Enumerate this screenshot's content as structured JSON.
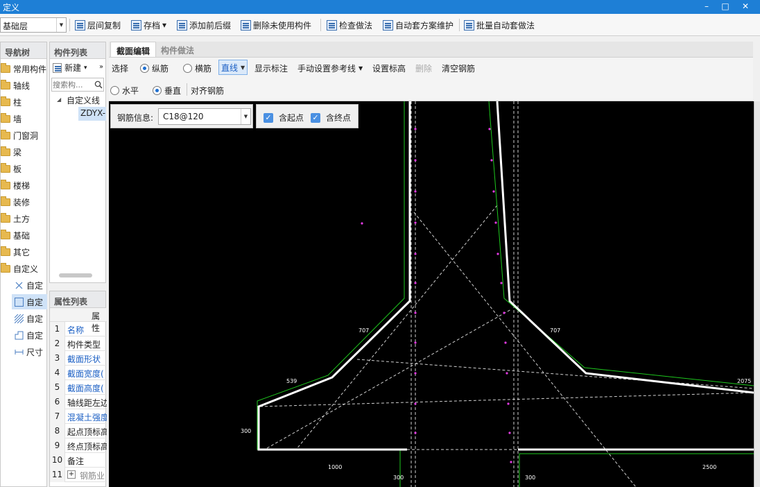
{
  "window": {
    "title": "定义",
    "min": "–",
    "max": "□",
    "close": "✕"
  },
  "toolbar": {
    "layer_value": "基础层",
    "items": [
      "层间复制",
      "存档",
      "添加前后缀",
      "删除未使用构件",
      "检查做法",
      "自动套方案维护",
      "批量自动套做法"
    ],
    "archive_arrow": "▾"
  },
  "nav": {
    "header": "导航树",
    "items": [
      "常用构件",
      "轴线",
      "柱",
      "墙",
      "门窗洞",
      "梁",
      "板",
      "楼梯",
      "装修",
      "土方",
      "基础",
      "其它",
      "自定义"
    ],
    "sub_items": [
      "自定",
      "自定",
      "自定",
      "自定",
      "尺寸"
    ]
  },
  "components": {
    "header": "构件列表",
    "new_label": "新建",
    "new_arrow": "▾",
    "more": "»",
    "search_placeholder": "搜索构...",
    "tree_parent": "自定义线",
    "tree_child": "ZDYX-"
  },
  "props": {
    "header": "属性列表",
    "col_header": "属性",
    "rows": [
      {
        "n": "1",
        "name": "名称",
        "blue": true
      },
      {
        "n": "2",
        "name": "构件类型",
        "blue": false
      },
      {
        "n": "3",
        "name": "截面形状",
        "blue": true
      },
      {
        "n": "4",
        "name": "截面宽度(",
        "blue": true
      },
      {
        "n": "5",
        "name": "截面高度(",
        "blue": true
      },
      {
        "n": "6",
        "name": "轴线距左边",
        "blue": false
      },
      {
        "n": "7",
        "name": "混凝土强度",
        "blue": true
      },
      {
        "n": "8",
        "name": "起点顶标高",
        "blue": false
      },
      {
        "n": "9",
        "name": "终点顶标高",
        "blue": false
      },
      {
        "n": "10",
        "name": "备注",
        "blue": false
      },
      {
        "n": "11",
        "name": "钢筋业",
        "blue": false
      }
    ],
    "expand": "+"
  },
  "editor": {
    "tab_active": "截面编辑",
    "tab_inactive": "构件做法",
    "row1": {
      "select": "选择",
      "longitudinal": "纵筋",
      "transverse": "横筋",
      "line_mode": "直线",
      "show_labels": "显示标注",
      "manual_ref": "手动设置参考线",
      "set_elev": "设置标高",
      "delete": "删除",
      "clear": "清空钢筋"
    },
    "row2": {
      "horizontal": "水平",
      "vertical": "垂直",
      "align": "对齐钢筋"
    },
    "rebar_label": "钢筋信息:",
    "rebar_value": "C18@120",
    "include_start": "含起点",
    "include_end": "含终点"
  },
  "drawing": {
    "dims": [
      "707",
      "707",
      "539",
      "2075",
      "300",
      "1000",
      "300",
      "300",
      "2500"
    ]
  }
}
